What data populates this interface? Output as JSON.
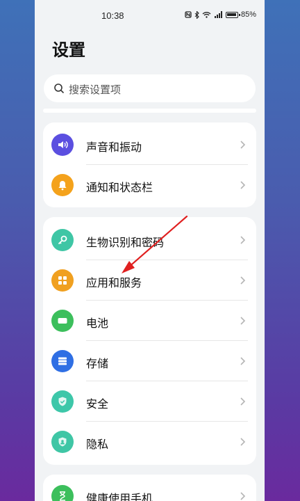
{
  "status_bar": {
    "time": "10:38",
    "icons": [
      "nfc-icon",
      "bluetooth-icon",
      "wifi-icon",
      "signal-icon",
      "battery-icon"
    ],
    "battery_percent": "85%"
  },
  "header": {
    "title": "设置"
  },
  "search": {
    "placeholder": "搜索设置项"
  },
  "groups": [
    {
      "items": [
        {
          "label": "声音和振动",
          "icon": "volume-icon",
          "color": "#5b4fe0"
        },
        {
          "label": "通知和状态栏",
          "icon": "bell-icon",
          "color": "#f4a21c"
        }
      ]
    },
    {
      "items": [
        {
          "label": "生物识别和密码",
          "icon": "key-icon",
          "color": "#3fc6a5"
        },
        {
          "label": "应用和服务",
          "icon": "apps-icon",
          "color": "#f0a020"
        },
        {
          "label": "电池",
          "icon": "battery-icon",
          "color": "#3cbf5c"
        },
        {
          "label": "存储",
          "icon": "storage-icon",
          "color": "#2f6fe4"
        },
        {
          "label": "安全",
          "icon": "shield-icon",
          "color": "#3dc7a9"
        },
        {
          "label": "隐私",
          "icon": "privacy-icon",
          "color": "#3fc6a5"
        }
      ]
    },
    {
      "items": [
        {
          "label": "健康使用手机",
          "icon": "hourglass-icon",
          "color": "#3cbf5c"
        }
      ]
    }
  ],
  "colors": {
    "annotation_arrow": "#e02020",
    "background": "#f1f3f5"
  }
}
